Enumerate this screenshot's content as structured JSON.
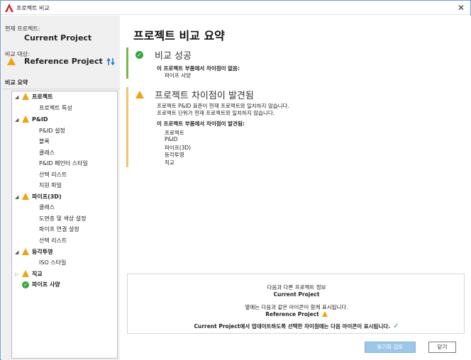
{
  "window": {
    "title": "프로젝트 비교",
    "close_icon": "close-icon"
  },
  "colors": {
    "warning": "#f0a30a",
    "success": "#3aa540",
    "accent_bar_ok": "#7ab648",
    "accent_bar_warn": "#f5c46a",
    "button_primary": "#9cc6ea"
  },
  "left": {
    "current_label": "현재 프로젝트:",
    "current_name": "Current Project",
    "compare_label": "비교 대상:",
    "compare_name": "Reference Project",
    "summary_label": "비교 요약"
  },
  "tree": {
    "project": {
      "label": "프로젝트",
      "children": [
        "프로젝트 특성"
      ]
    },
    "pid": {
      "label": "P&ID",
      "children": [
        "P&ID 설정",
        "블록",
        "클래스",
        "P&ID 페인터 스타일",
        "선택 리스트",
        "지원 파일"
      ]
    },
    "pipe3d": {
      "label": "파이프(3D)",
      "children": [
        "클래스",
        "도면층 및 색상 설정",
        "파이프 연결 설정",
        "선택 리스트"
      ]
    },
    "iso": {
      "label": "등각투영",
      "children": [
        "ISO 스타일"
      ]
    },
    "ortho": {
      "label": "직교"
    },
    "pipespec": {
      "label": "파이프 사양"
    }
  },
  "main": {
    "title": "프로젝트 비교 요약",
    "success": {
      "title": "비교 성공",
      "no_diff_label": "이 프로젝트 부품에서 차이점이 없음:",
      "items": [
        "파이프 사양"
      ]
    },
    "diff": {
      "title": "프로젝트 차이점이 발견됨",
      "line1": "프로젝트 P&ID 표준이 현재 프로젝트와 일치하지 않습니다.",
      "line2": "프로젝트 단위가 현재 프로젝트와 일치하지 않습니다.",
      "found_label": "이 프로젝트 부품에서 차이점이 발견됨:",
      "items": [
        "프로젝트",
        "P&ID",
        "파이프(3D)",
        "등각투영",
        "직교"
      ]
    },
    "info": {
      "line1": "다음과 다른 프로젝트 정보",
      "line2": "Current Project",
      "line3": "옆에는 다음과 같은 아이콘이 함께 표시됩니다.",
      "line4": "Reference Project",
      "line5": "Current Project에서 업데이트하도록 선택한 차이점에는 다음 아이콘이 표시됩니다."
    },
    "buttons": {
      "sync": "동기화 검토",
      "close": "닫기"
    }
  }
}
